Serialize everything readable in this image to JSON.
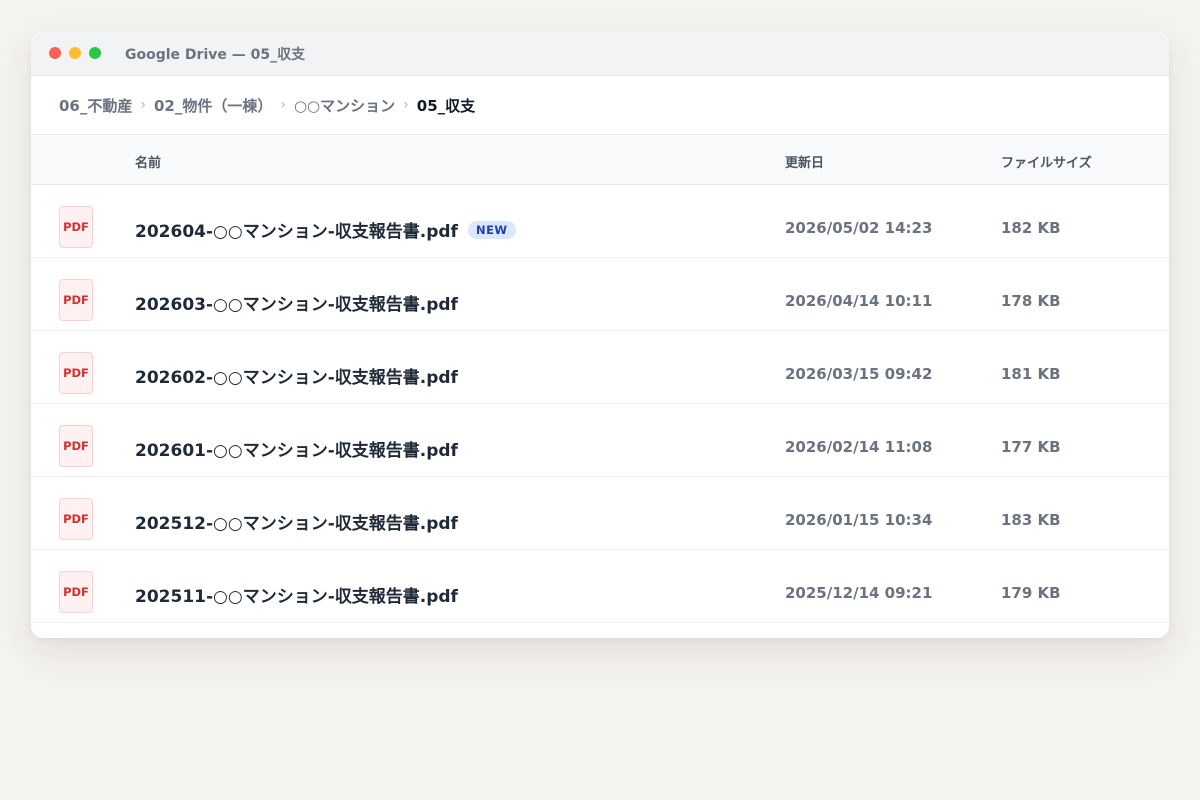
{
  "window": {
    "title": "Google Drive — 05_収支"
  },
  "breadcrumb": {
    "items": [
      {
        "label": "06_不動産"
      },
      {
        "label": "02_物件（一棟）"
      },
      {
        "label": "○○マンション"
      },
      {
        "label": "05_収支"
      }
    ],
    "separator": "›"
  },
  "table": {
    "headers": {
      "name": "名前",
      "modified": "更新日",
      "size": "ファイルサイズ"
    },
    "rows": [
      {
        "icon": "PDF",
        "name": "202604-○○マンション-収支報告書.pdf",
        "badge": "NEW",
        "modified": "2026/05/02 14:23",
        "size": "182 KB"
      },
      {
        "icon": "PDF",
        "name": "202603-○○マンション-収支報告書.pdf",
        "modified": "2026/04/14 10:11",
        "size": "178 KB"
      },
      {
        "icon": "PDF",
        "name": "202602-○○マンション-収支報告書.pdf",
        "modified": "2026/03/15 09:42",
        "size": "181 KB"
      },
      {
        "icon": "PDF",
        "name": "202601-○○マンション-収支報告書.pdf",
        "modified": "2026/02/14 11:08",
        "size": "177 KB"
      },
      {
        "icon": "PDF",
        "name": "202512-○○マンション-収支報告書.pdf",
        "modified": "2026/01/15 10:34",
        "size": "183 KB"
      },
      {
        "icon": "PDF",
        "name": "202511-○○マンション-収支報告書.pdf",
        "modified": "2025/12/14 09:21",
        "size": "179 KB"
      }
    ]
  },
  "colors": {
    "pdf_red": "#d32f2f",
    "badge_blue": "#1e40af",
    "badge_bg": "#dbe7fb"
  },
  "icons": {
    "file_type": "pdf-file-icon"
  }
}
